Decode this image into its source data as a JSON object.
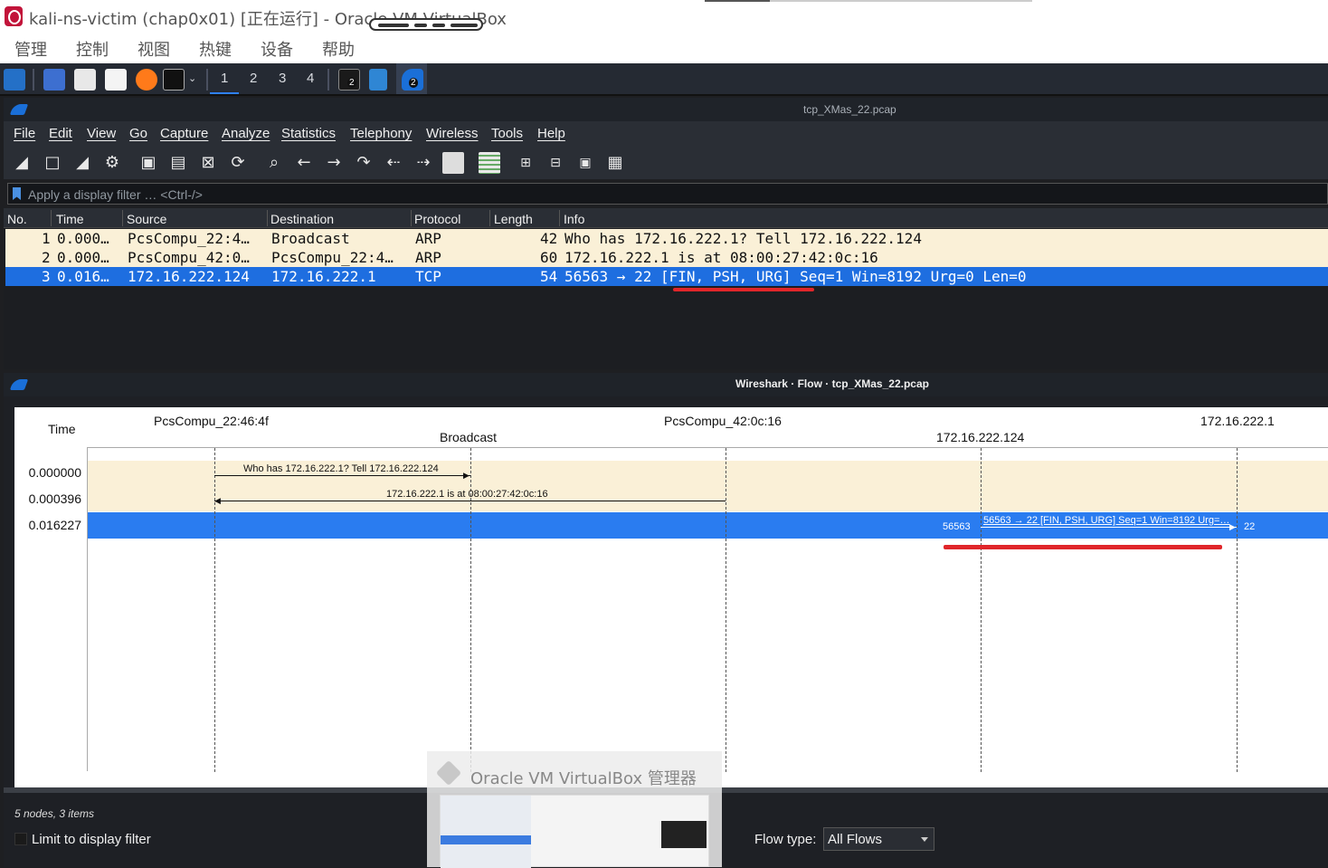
{
  "host_window": {
    "title": "kali-ns-victim (chap0x01) [正在运行] - Oracle VM VirtualBox",
    "menu": [
      "管理",
      "控制",
      "视图",
      "热键",
      "设备",
      "帮助"
    ]
  },
  "taskbar": {
    "workspaces": [
      "1",
      "2",
      "3",
      "4"
    ],
    "badges": [
      "2",
      "2"
    ]
  },
  "wireshark": {
    "title": "tcp_XMas_22.pcap",
    "menu": [
      "File",
      "Edit",
      "View",
      "Go",
      "Capture",
      "Analyze",
      "Statistics",
      "Telephony",
      "Wireless",
      "Tools",
      "Help"
    ],
    "filter_placeholder": "Apply a display filter … <Ctrl-/>",
    "columns": [
      "No.",
      "Time",
      "Source",
      "Destination",
      "Protocol",
      "Length",
      "Info"
    ],
    "packets": [
      {
        "no": "1",
        "time": "0.000…",
        "src": "PcsCompu_22:4…",
        "dst": "Broadcast",
        "proto": "ARP",
        "len": "42",
        "info": "Who has 172.16.222.1? Tell 172.16.222.124"
      },
      {
        "no": "2",
        "time": "0.000…",
        "src": "PcsCompu_42:0…",
        "dst": "PcsCompu_22:4…",
        "proto": "ARP",
        "len": "60",
        "info": "172.16.222.1 is at 08:00:27:42:0c:16"
      },
      {
        "no": "3",
        "time": "0.016…",
        "src": "172.16.222.124",
        "dst": "172.16.222.1",
        "proto": "TCP",
        "len": "54",
        "info": "56563 → 22 [FIN, PSH, URG] Seq=1 Win=8192 Urg=0 Len=0"
      }
    ],
    "colors": {
      "selected": "#1e6ee0",
      "arp_row": "#faf0d7",
      "highlight": "#e0262a"
    }
  },
  "flow": {
    "title": "Wireshark · Flow · tcp_XMas_22.pcap",
    "time_header": "Time",
    "nodes": [
      "PcsCompu_22:46:4f",
      "Broadcast",
      "PcsCompu_42:0c:16",
      "172.16.222.124",
      "172.16.222.1"
    ],
    "items": [
      {
        "time": "0.000000",
        "label": "Who has 172.16.222.1? Tell 172.16.222.124"
      },
      {
        "time": "0.000396",
        "label": "172.16.222.1 is at 08:00:27:42:0c:16"
      },
      {
        "time": "0.016227",
        "label": "56563 → 22 [FIN, PSH, URG] Seq=1 Win=8192 Urg=…",
        "src_port": "56563",
        "dst_port": "22"
      }
    ],
    "status": "5 nodes, 3 items",
    "limit_label": "Limit to display filter",
    "flow_type_label": "Flow type:",
    "flow_type_value": "All Flows"
  },
  "overlay": {
    "title": "Oracle VM VirtualBox 管理器"
  }
}
